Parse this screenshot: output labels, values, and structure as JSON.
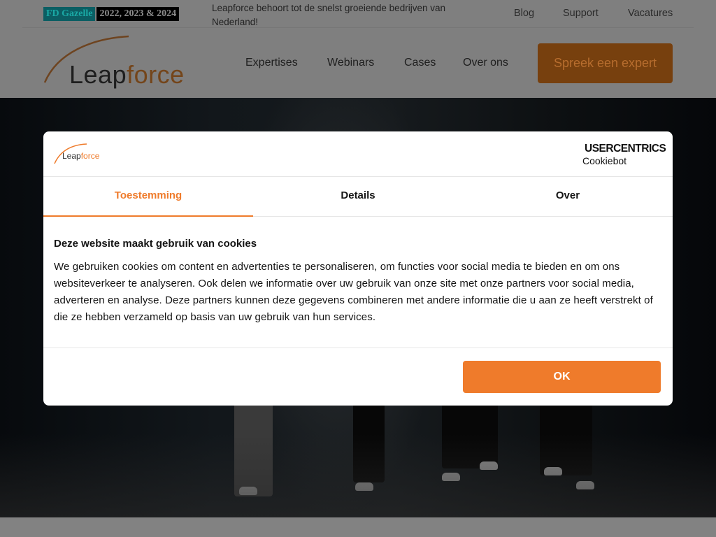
{
  "topbar": {
    "badge_left": "FD Gazelle",
    "badge_right": "2022, 2023 & 2024",
    "tagline": "Leapforce behoort tot de snelst groeiende bedrijven van Nederland!",
    "links": [
      "Blog",
      "Support",
      "Vacatures"
    ]
  },
  "header": {
    "logo_part1": "Leap",
    "logo_part2": "force",
    "nav": [
      "Expertises",
      "Webinars",
      "Cases",
      "Over ons"
    ],
    "cta": "Spreek een expert"
  },
  "cookie_dialog": {
    "logo_part1": "Leap",
    "logo_part2": "force",
    "provider": "USERCENTRICS",
    "provider_sub": "Cookiebot",
    "tabs": [
      {
        "label": "Toestemming",
        "active": true
      },
      {
        "label": "Details",
        "active": false
      },
      {
        "label": "Over",
        "active": false
      }
    ],
    "title": "Deze website maakt gebruik van cookies",
    "text": "We gebruiken cookies om content en advertenties te personaliseren, om functies voor social media te bieden en om ons websiteverkeer te analyseren. Ook delen we informatie over uw gebruik van onze site met onze partners voor social media, adverteren en analyse. Deze partners kunnen deze gegevens combineren met andere informatie die u aan ze heeft verstrekt of die ze hebben verzameld op basis van uw gebruik van hun services.",
    "ok_label": "OK"
  },
  "colors": {
    "accent": "#ef7b2b",
    "overlay": "#808080",
    "dialog_bg": "#ffffff"
  }
}
